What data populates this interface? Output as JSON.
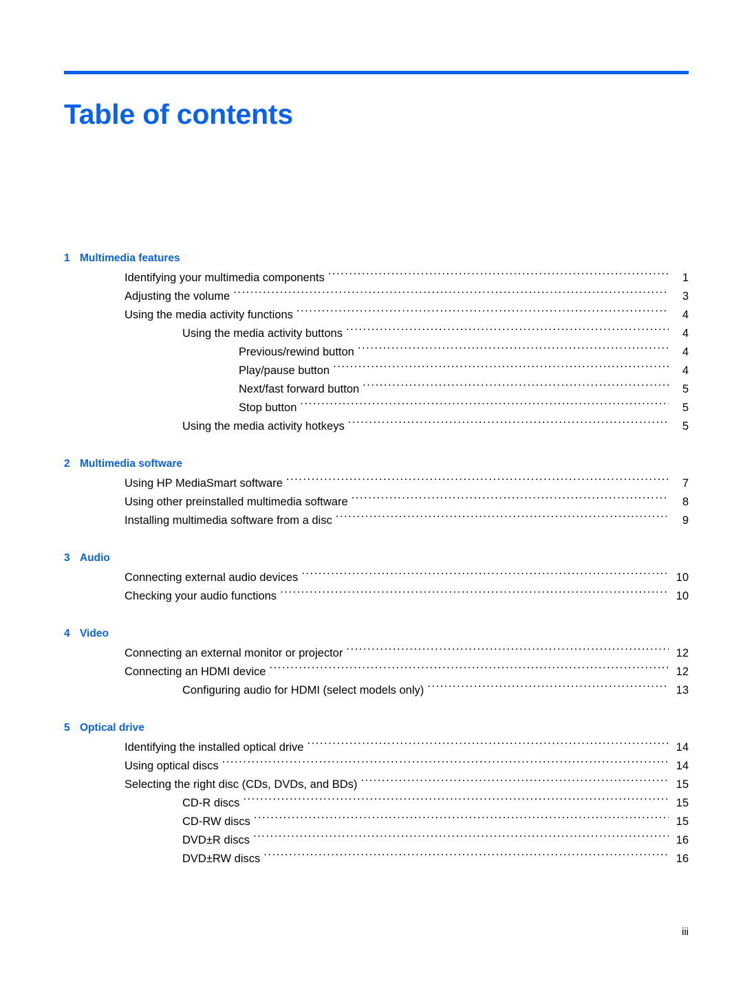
{
  "document": {
    "title": "Table of contents",
    "folio": "iii",
    "accent_color": "#0a62ec",
    "text_color": "#000000"
  },
  "toc": {
    "chapters": [
      {
        "number": "1",
        "title": "Multimedia features",
        "entries": [
          {
            "level": 1,
            "text": "Identifying your multimedia components",
            "page": "1"
          },
          {
            "level": 1,
            "text": "Adjusting the volume",
            "page": "3"
          },
          {
            "level": 1,
            "text": "Using the media activity functions",
            "page": "4"
          },
          {
            "level": 2,
            "text": "Using the media activity buttons",
            "page": "4"
          },
          {
            "level": 3,
            "text": "Previous/rewind button",
            "page": "4"
          },
          {
            "level": 3,
            "text": "Play/pause button",
            "page": "4"
          },
          {
            "level": 3,
            "text": "Next/fast forward button",
            "page": "5"
          },
          {
            "level": 3,
            "text": "Stop button",
            "page": "5"
          },
          {
            "level": 2,
            "text": "Using the media activity hotkeys",
            "page": "5"
          }
        ]
      },
      {
        "number": "2",
        "title": "Multimedia software",
        "entries": [
          {
            "level": 1,
            "text": "Using HP MediaSmart software",
            "page": "7"
          },
          {
            "level": 1,
            "text": "Using other preinstalled multimedia software",
            "page": "8"
          },
          {
            "level": 1,
            "text": "Installing multimedia software from a disc",
            "page": "9"
          }
        ]
      },
      {
        "number": "3",
        "title": "Audio",
        "entries": [
          {
            "level": 1,
            "text": "Connecting external audio devices",
            "page": "10"
          },
          {
            "level": 1,
            "text": "Checking your audio functions",
            "page": "10"
          }
        ]
      },
      {
        "number": "4",
        "title": "Video",
        "entries": [
          {
            "level": 1,
            "text": "Connecting an external monitor or projector",
            "page": "12"
          },
          {
            "level": 1,
            "text": "Connecting an HDMI device",
            "page": "12"
          },
          {
            "level": 2,
            "text": "Configuring audio for HDMI (select models only)",
            "page": "13"
          }
        ]
      },
      {
        "number": "5",
        "title": "Optical drive",
        "entries": [
          {
            "level": 1,
            "text": "Identifying the installed optical drive",
            "page": "14"
          },
          {
            "level": 1,
            "text": "Using optical discs",
            "page": "14"
          },
          {
            "level": 1,
            "text": "Selecting the right disc (CDs, DVDs, and BDs)",
            "page": "15"
          },
          {
            "level": 2,
            "text": "CD-R discs",
            "page": "15"
          },
          {
            "level": 2,
            "text": "CD-RW discs",
            "page": "15"
          },
          {
            "level": 2,
            "text": "DVD±R discs",
            "page": "16"
          },
          {
            "level": 2,
            "text": "DVD±RW discs",
            "page": "16"
          }
        ]
      }
    ]
  }
}
